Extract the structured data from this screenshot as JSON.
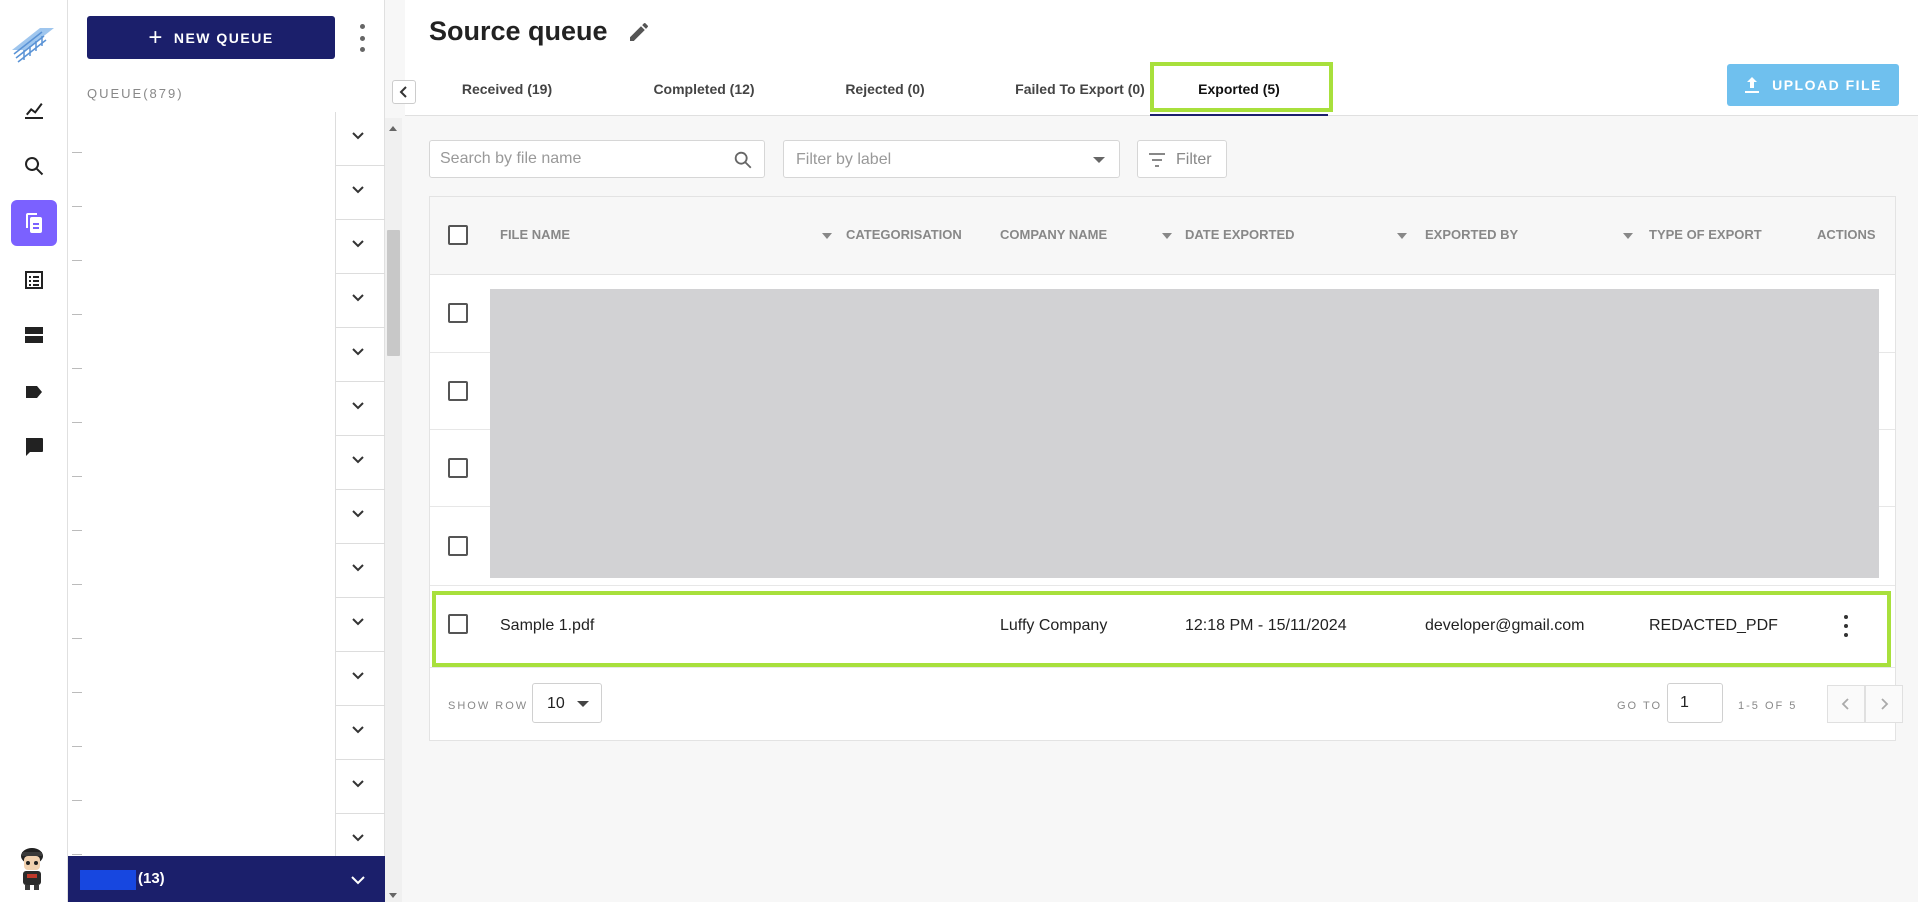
{
  "sidebar": {
    "icons": [
      "logo-icon",
      "analytics-icon",
      "search-icon",
      "documents-icon",
      "list-icon",
      "storage-icon",
      "label-icon",
      "chat-icon"
    ],
    "active": "documents-icon"
  },
  "queue_panel": {
    "new_queue_label": "NEW QUEUE",
    "queue_label": "QUEUE(879)",
    "footer_count": "(13)"
  },
  "header": {
    "title": "Source queue",
    "upload_label": "UPLOAD FILE",
    "tabs": [
      {
        "label": "Received (19)"
      },
      {
        "label": "Completed (12)"
      },
      {
        "label": "Rejected (0)"
      },
      {
        "label": "Failed To Export (0)"
      },
      {
        "label": "Exported (5)"
      }
    ],
    "active_tab": "Exported (5)"
  },
  "filters": {
    "search_placeholder": "Search by file name",
    "label_placeholder": "Filter by label",
    "filter_label": "Filter"
  },
  "table": {
    "columns": [
      "FILE NAME",
      "CATEGORISATION",
      "COMPANY NAME",
      "DATE EXPORTED",
      "EXPORTED BY",
      "TYPE OF EXPORT",
      "ACTIONS"
    ],
    "row": {
      "file_name": "Sample 1.pdf",
      "categorisation": "",
      "company_name": "Luffy Company",
      "date_exported": "12:18 PM - 15/11/2024",
      "exported_by": "developer@gmail.com",
      "type_of_export": "REDACTED_PDF"
    }
  },
  "pagination": {
    "show_row_label": "SHOW ROW",
    "rows_per_page": "10",
    "goto_label": "GO TO",
    "goto_value": "1",
    "range": "1-5 OF 5"
  },
  "colors": {
    "brand": "#1b1f6b",
    "accent": "#7b61ff",
    "highlight": "#a8e03c",
    "upload": "#6fc0ee"
  }
}
